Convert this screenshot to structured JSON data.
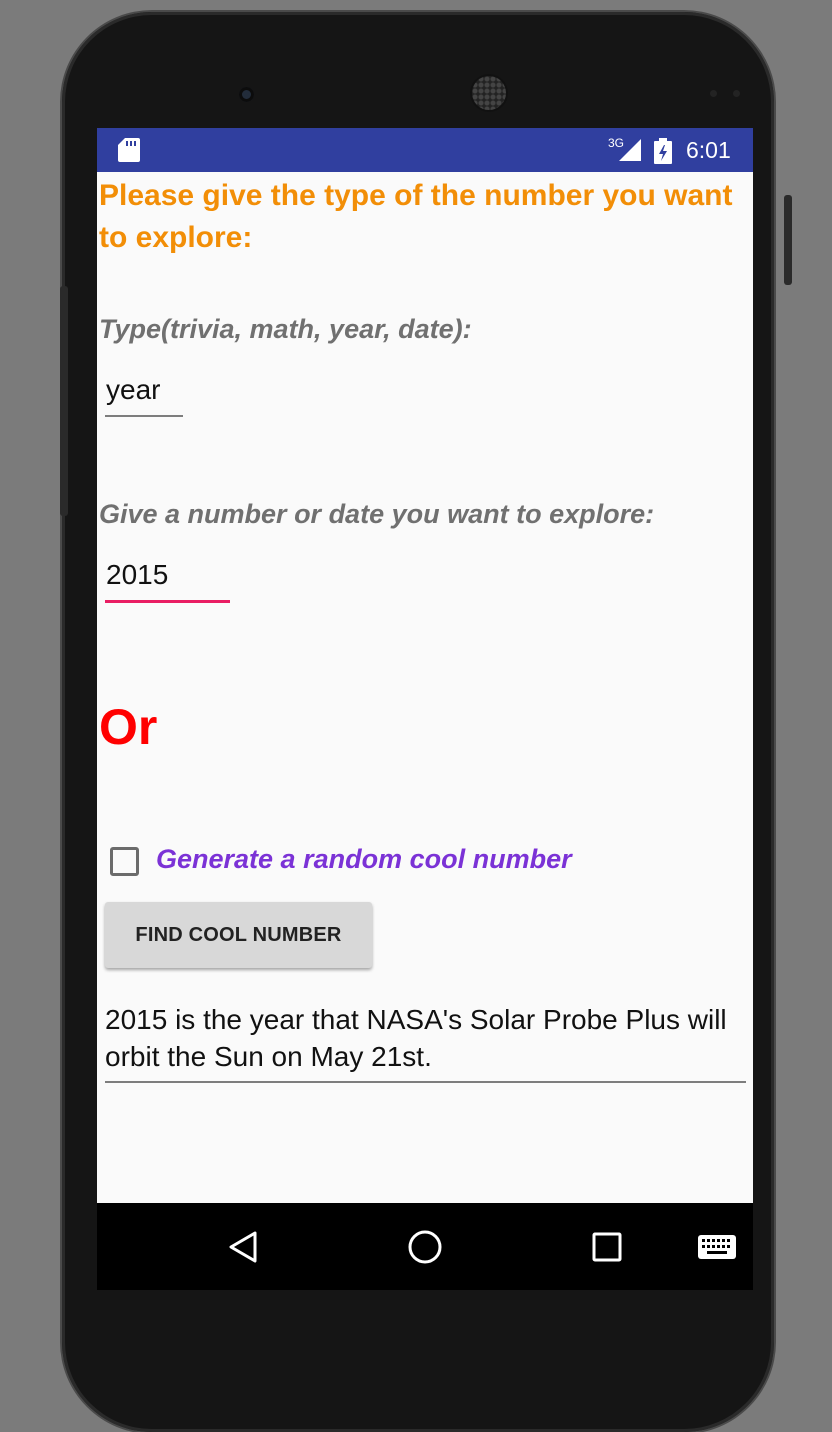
{
  "status_bar": {
    "network": "3G",
    "time": "6:01",
    "icons": [
      "sd-card-icon",
      "signal-icon",
      "battery-icon"
    ]
  },
  "form": {
    "heading": "Please give the type of the number you want to explore:",
    "type_label": "Type(trivia, math, year, date):",
    "type_value": "year",
    "number_label": "Give a number or date you want to explore:",
    "number_value": "2015",
    "or_label": "Or",
    "random_checkbox": {
      "label": "Generate a random cool number",
      "checked": false
    },
    "find_button": "FIND COOL NUMBER",
    "result": "2015 is the year that NASA's Solar Probe Plus will orbit the Sun on May 21st."
  },
  "nav_bar": {
    "icons": [
      "back-icon",
      "home-icon",
      "recents-icon",
      "keyboard-icon"
    ]
  },
  "colors": {
    "status_bar": "#303f9f",
    "heading": "#f28e07",
    "or": "#ff0000",
    "checkbox_label": "#7b32d6",
    "active_underline": "#e91e63"
  }
}
